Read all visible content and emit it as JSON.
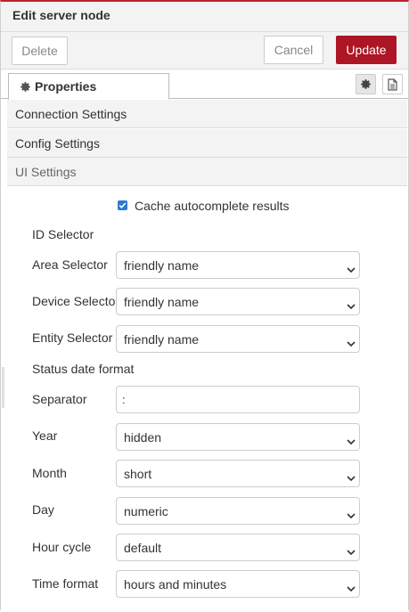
{
  "header": {
    "title": "Edit server node"
  },
  "toolbar": {
    "delete_label": "Delete",
    "cancel_label": "Cancel",
    "update_label": "Update",
    "accent": "#ad1625"
  },
  "tabs": [
    {
      "label": "Properties",
      "icon": "gear-icon"
    }
  ],
  "tab_actions": [
    {
      "icon": "gear-icon"
    },
    {
      "icon": "document-icon"
    }
  ],
  "sections": {
    "connection": "Connection Settings",
    "config": "Config Settings",
    "ui": "UI Settings"
  },
  "ui_settings": {
    "cache_checkbox": {
      "label": "Cache autocomplete results",
      "checked": true
    },
    "id_selector_heading": "ID Selector",
    "area_selector": {
      "label": "Area Selector",
      "value": "friendly name"
    },
    "device_selector": {
      "label": "Device Selector",
      "value": "friendly name"
    },
    "entity_selector": {
      "label": "Entity Selector",
      "value": "friendly name"
    },
    "status_date_heading": "Status date format",
    "separator": {
      "label": "Separator",
      "value": ":"
    },
    "year": {
      "label": "Year",
      "value": "hidden"
    },
    "month": {
      "label": "Month",
      "value": "short"
    },
    "day": {
      "label": "Day",
      "value": "numeric"
    },
    "hour_cycle": {
      "label": "Hour cycle",
      "value": "default"
    },
    "time_format": {
      "label": "Time format",
      "value": "hours and minutes"
    }
  }
}
